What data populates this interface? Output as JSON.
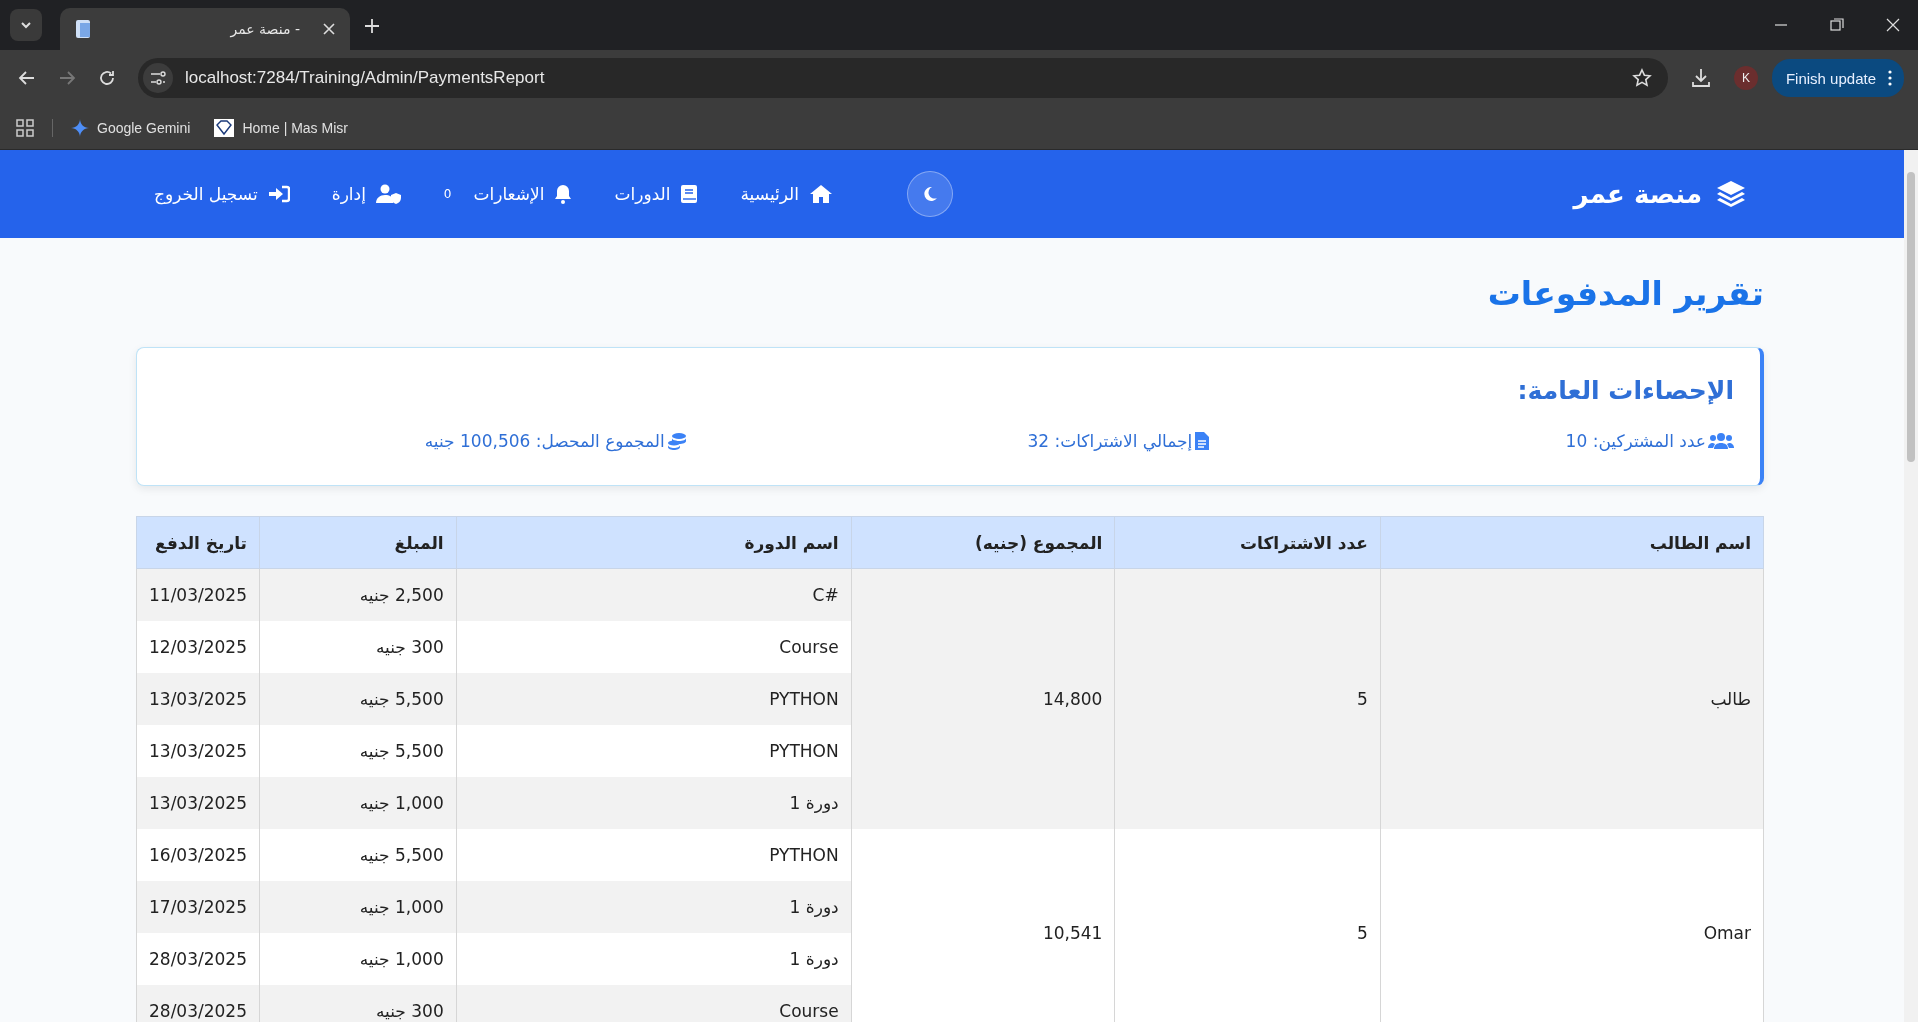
{
  "browser": {
    "tab_title": "منصة عمر -",
    "url": "localhost:7284/Training/Admin/PaymentsReport",
    "gemini_bookmark": "Google Gemini",
    "site_bookmark": "Home | Mas Misr",
    "profile_initial": "K",
    "update_button": "Finish update"
  },
  "navbar": {
    "brand": "منصة عمر",
    "items": [
      {
        "kind": "home",
        "label": "الرئيسية"
      },
      {
        "kind": "courses",
        "label": "الدورات"
      },
      {
        "kind": "notifications",
        "label": "الإشعارات",
        "badge": "0"
      },
      {
        "kind": "admin",
        "label": "إدارة"
      },
      {
        "kind": "logout",
        "label": "تسجيل الخروج"
      }
    ]
  },
  "page_title": "تقرير المدفوعات",
  "stats": {
    "title": "الإحصاءات العامة:",
    "items": [
      {
        "kind": "users",
        "text": "عدد المشتركين: 10"
      },
      {
        "kind": "file",
        "text": "إجمالي الاشتراكات: 32"
      },
      {
        "kind": "coins",
        "text": "المجموع المحصل: 100,506 جنيه"
      }
    ]
  },
  "table": {
    "columns": [
      "اسم الطالب",
      "عدد الاشتراكات",
      "المجموع (جنيه)",
      "اسم الدورة",
      "المبلغ",
      "تاريخ الدفع"
    ],
    "groups": [
      {
        "student": "طالب",
        "count": "5",
        "total": "14,800",
        "payments": [
          {
            "course": "C#",
            "amount": "2,500 جنيه",
            "date": "11/03/2025"
          },
          {
            "course": "Course",
            "amount": "300 جنيه",
            "date": "12/03/2025"
          },
          {
            "course": "PYTHON",
            "amount": "5,500 جنيه",
            "date": "13/03/2025"
          },
          {
            "course": "PYTHON",
            "amount": "5,500 جنيه",
            "date": "13/03/2025"
          },
          {
            "course": "دورة 1",
            "amount": "1,000 جنيه",
            "date": "13/03/2025"
          }
        ]
      },
      {
        "student": "Omar",
        "count": "5",
        "total": "10,541",
        "payments": [
          {
            "course": "PYTHON",
            "amount": "5,500 جنيه",
            "date": "16/03/2025"
          },
          {
            "course": "دورة 1",
            "amount": "1,000 جنيه",
            "date": "17/03/2025"
          },
          {
            "course": "دورة 1",
            "amount": "1,000 جنيه",
            "date": "28/03/2025"
          },
          {
            "course": "Course",
            "amount": "300 جنيه",
            "date": "28/03/2025"
          }
        ]
      }
    ]
  }
}
